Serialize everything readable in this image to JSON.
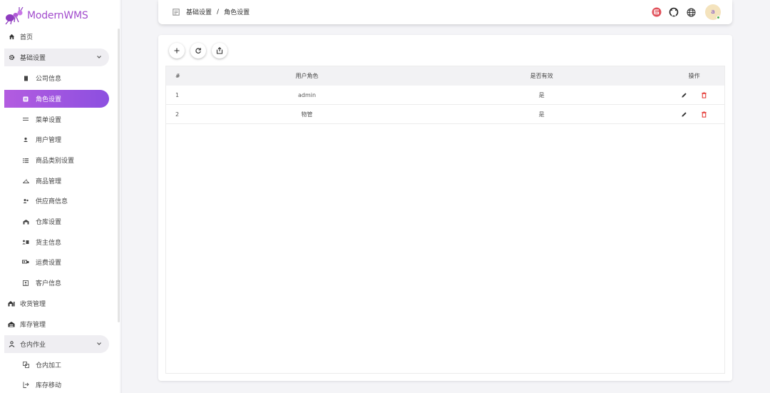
{
  "app": {
    "title": "ModernWMS"
  },
  "colors": {
    "accent": "#a24ccd",
    "active_gradient_start": "#b35ce0",
    "active_gradient_end": "#8c4fe0",
    "delete": "#e53935"
  },
  "sidebar": {
    "items": [
      {
        "label": "首页",
        "icon": "home-icon"
      },
      {
        "label": "基础设置",
        "icon": "gear-icon",
        "expanded": true
      },
      {
        "label": "公司信息",
        "icon": "document-icon"
      },
      {
        "label": "角色设置",
        "icon": "id-card-icon",
        "active": true
      },
      {
        "label": "菜单设置",
        "icon": "menu-lines-icon"
      },
      {
        "label": "用户管理",
        "icon": "person-icon"
      },
      {
        "label": "商品类别设置",
        "icon": "list-icon"
      },
      {
        "label": "商品管理",
        "icon": "hanger-icon"
      },
      {
        "label": "供应商信息",
        "icon": "people-icon"
      },
      {
        "label": "仓库设置",
        "icon": "warehouse-icon"
      },
      {
        "label": "货主信息",
        "icon": "contact-card-icon"
      },
      {
        "label": "运费设置",
        "icon": "freight-icon"
      },
      {
        "label": "客户信息",
        "icon": "customer-icon"
      },
      {
        "label": "收货管理",
        "icon": "receiving-icon"
      },
      {
        "label": "库存管理",
        "icon": "stock-icon"
      },
      {
        "label": "仓内作业",
        "icon": "worker-icon",
        "expanded": true
      },
      {
        "label": "仓内加工",
        "icon": "processing-icon"
      },
      {
        "label": "库存移动",
        "icon": "move-icon"
      }
    ]
  },
  "header": {
    "breadcrumb": [
      "基础设置",
      "角色设置"
    ],
    "breadcrumb_sep": "/",
    "avatar_letter": "a",
    "icons": [
      "gitee-icon",
      "github-icon",
      "globe-icon"
    ]
  },
  "toolbar": {
    "buttons": [
      "add-icon",
      "refresh-icon",
      "export-icon"
    ]
  },
  "table": {
    "columns": [
      "#",
      "用户角色",
      "是否有效",
      "操作"
    ],
    "rows": [
      {
        "num": "1",
        "role": "admin",
        "valid": "是"
      },
      {
        "num": "2",
        "role": "物管",
        "valid": "是"
      }
    ]
  }
}
